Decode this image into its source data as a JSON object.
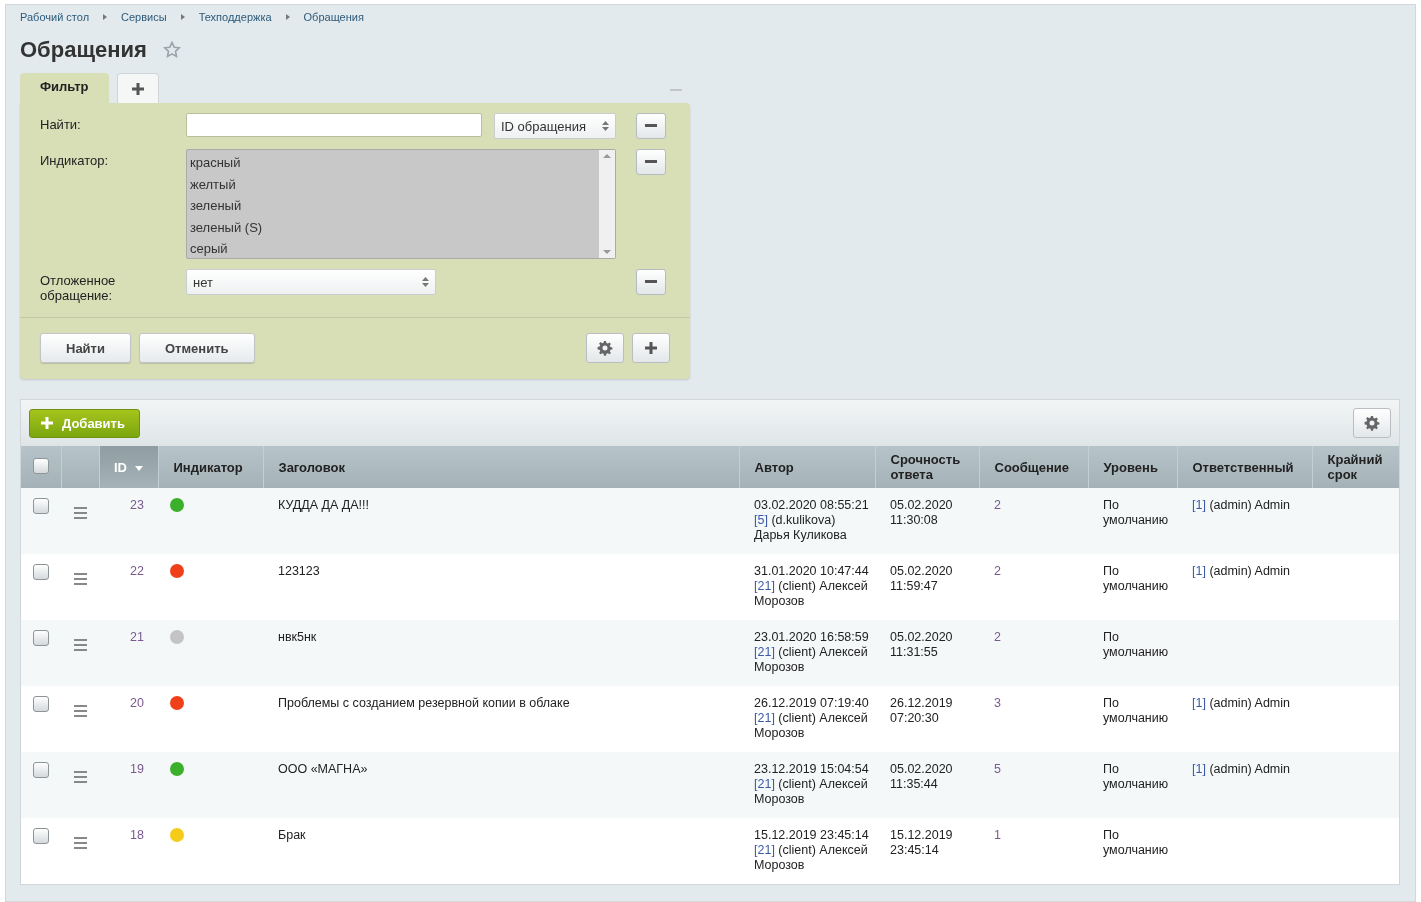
{
  "breadcrumbs": [
    "Рабочий стол",
    "Сервисы",
    "Техподдержка",
    "Обращения"
  ],
  "title": "Обращения",
  "filter": {
    "tabs": [
      {
        "label": "Фильтр",
        "selected": true
      }
    ],
    "fields": [
      {
        "kind": "text",
        "label": "Найти:",
        "select": "ID обращения"
      },
      {
        "kind": "list",
        "label": "Индикатор:",
        "options": [
          "красный",
          "желтый",
          "зеленый",
          "зеленый (S)",
          "серый"
        ]
      },
      {
        "kind": "select",
        "label": "Отложенное обращение:",
        "select": "нет"
      }
    ],
    "buttons": [
      "Найти",
      "Отменить"
    ]
  },
  "toolbar": {
    "add_button": "Добавить"
  },
  "table": {
    "columns": [
      "ID",
      "Индикатор",
      "Заголовок",
      "Автор",
      "Срочность ответа",
      "Сообщение",
      "Уровень",
      "Ответственный",
      "Крайний срок"
    ],
    "all_checked": false,
    "rows": [
      {
        "checked": false,
        "id": "23",
        "color": "#3cb02a",
        "title": "КУДДА ДА ДА!!!",
        "date": "03.02.2020 08:55:21",
        "author_link": "[5]",
        "author": "(d.kulikova) Дарья Куликова",
        "urgency": "05.02.2020 11:30:08",
        "messages": "2",
        "level": "По умолчанию",
        "resp_link": "[1]",
        "resp": "(admin) Admin"
      },
      {
        "checked": false,
        "id": "22",
        "color": "#f0401a",
        "title": "123123",
        "date": "31.01.2020 10:47:44",
        "author_link": "[21]",
        "author": "(client) Алексей Морозов",
        "urgency": "05.02.2020 11:59:47",
        "messages": "2",
        "level": "По умолчанию",
        "resp_link": "[1]",
        "resp": "(admin) Admin"
      },
      {
        "checked": false,
        "id": "21",
        "color": "#c4c4c4",
        "title": "нвк5нк",
        "date": "23.01.2020 16:58:59",
        "author_link": "[21]",
        "author": "(client) Алексей Морозов",
        "urgency": "05.02.2020 11:31:55",
        "messages": "2",
        "level": "По умолчанию"
      },
      {
        "checked": false,
        "id": "20",
        "color": "#f0401a",
        "title": "Проблемы с созданием резервной копии в облаке",
        "date": "26.12.2019 07:19:40",
        "author_link": "[21]",
        "author": "(client) Алексей Морозов",
        "urgency": "26.12.2019 07:20:30",
        "messages": "3",
        "level": "По умолчанию",
        "resp_link": "[1]",
        "resp": "(admin) Admin"
      },
      {
        "checked": false,
        "id": "19",
        "color": "#3cb02a",
        "title": "ООО «МАГНА»",
        "date": "23.12.2019 15:04:54",
        "author_link": "[21]",
        "author": "(client) Алексей Морозов",
        "urgency": "05.02.2020 11:35:44",
        "messages": "5",
        "level": "По умолчанию",
        "resp_link": "[1]",
        "resp": "(admin) Admin"
      },
      {
        "checked": false,
        "id": "18",
        "color": "#f5cc1a",
        "title": "Брак",
        "date": "15.12.2019 23:45:14",
        "author_link": "[21]",
        "author": "(client) Алексей Морозов",
        "urgency": "15.12.2019 23:45:14",
        "messages": "1",
        "level": "По умолчанию"
      }
    ]
  }
}
